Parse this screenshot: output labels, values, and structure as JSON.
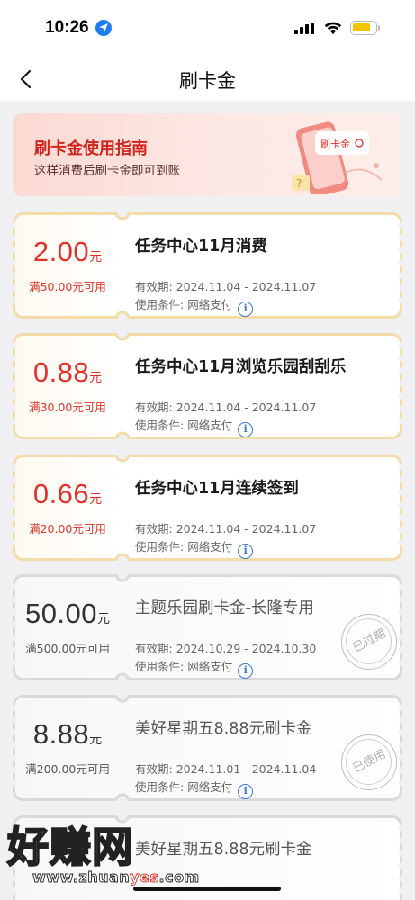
{
  "status_bar": {
    "time": "10:26"
  },
  "nav": {
    "title": "刷卡金",
    "back_icon": "chevron-left-icon"
  },
  "guide": {
    "title": "刷卡金使用指南",
    "subtitle": "这样消费后刷卡金即可到账",
    "illustration_label": "刷卡金"
  },
  "labels": {
    "validity": "有效期:",
    "condition_label": "使用条件:",
    "info": "i"
  },
  "colors": {
    "active_accent": "#e0322a",
    "active_border": "#f3dca8",
    "expired_border": "#d9d9d9"
  },
  "coupons": [
    {
      "status": "active",
      "amount": "2.00",
      "unit": "元",
      "min_spend": "满50.00元可用",
      "title": "任务中心11月消费",
      "validity": "2024.11.04 - 2024.11.07",
      "condition": "网络支付",
      "stamp": ""
    },
    {
      "status": "active",
      "amount": "0.88",
      "unit": "元",
      "min_spend": "满30.00元可用",
      "title": "任务中心11月浏览乐园刮刮乐",
      "validity": "2024.11.04 - 2024.11.07",
      "condition": "网络支付",
      "stamp": ""
    },
    {
      "status": "active",
      "amount": "0.66",
      "unit": "元",
      "min_spend": "满20.00元可用",
      "title": "任务中心11月连续签到",
      "validity": "2024.11.04 - 2024.11.07",
      "condition": "网络支付",
      "stamp": ""
    },
    {
      "status": "expired",
      "amount": "50.00",
      "unit": "元",
      "min_spend": "满500.00元可用",
      "title": "主题乐园刷卡金-长隆专用",
      "validity": "2024.10.29 - 2024.10.30",
      "condition": "网络支付",
      "stamp": "已过期"
    },
    {
      "status": "used",
      "amount": "8.88",
      "unit": "元",
      "min_spend": "满200.00元可用",
      "title": "美好星期五8.88元刷卡金",
      "validity": "2024.11.01 - 2024.11.04",
      "condition": "网络支付",
      "stamp": "已使用"
    },
    {
      "status": "used",
      "amount": "",
      "unit": "",
      "min_spend": "",
      "title": "美好星期五8.88元刷卡金",
      "validity": "",
      "condition": "",
      "stamp": ""
    }
  ],
  "watermark": {
    "text": "好赚网",
    "url_prefix": "www.zhuan",
    "url_highlight": "yes",
    "url_suffix": ".com"
  }
}
